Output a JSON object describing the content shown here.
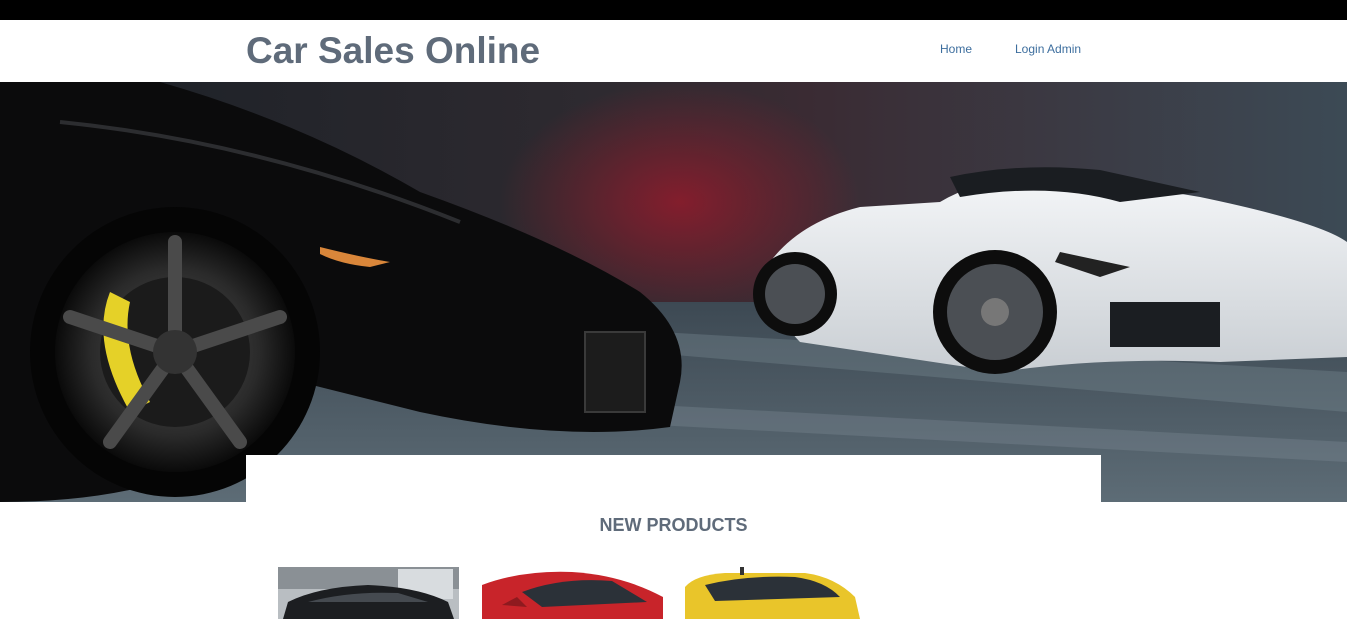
{
  "header": {
    "site_title": "Car Sales Online",
    "nav": [
      {
        "label": "Home"
      },
      {
        "label": "Login Admin"
      }
    ]
  },
  "hero": {
    "image": "hero-banner-two-sports-cars"
  },
  "products_section": {
    "title": "NEW PRODUCTS",
    "products": [
      {
        "image": "black-car-thumbnail"
      },
      {
        "image": "red-car-thumbnail"
      },
      {
        "image": "yellow-car-thumbnail"
      }
    ]
  },
  "colors": {
    "title_text": "#5f6b7a",
    "nav_link": "#3d6e9e",
    "top_bar": "#000000"
  }
}
